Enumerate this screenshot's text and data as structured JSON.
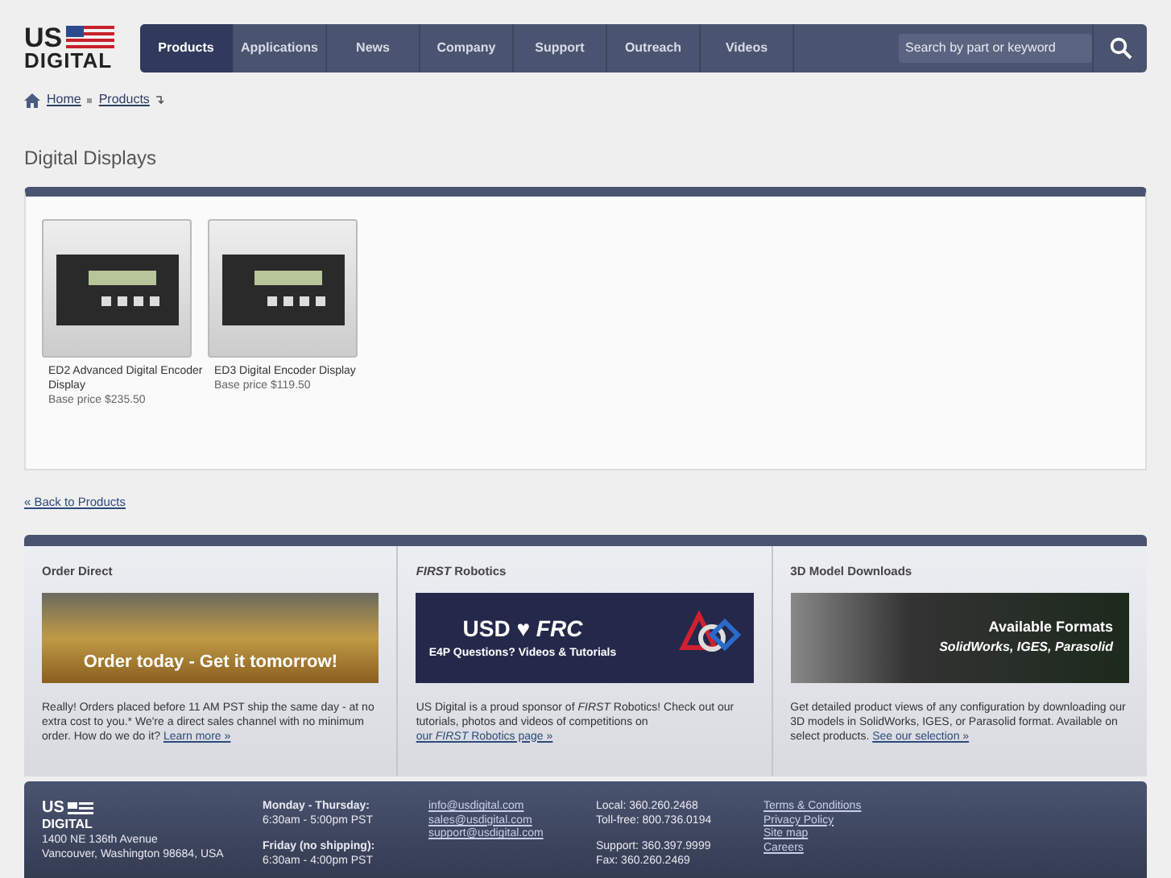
{
  "logo": {
    "line_1": "US",
    "line_2": "DIGITAL"
  },
  "nav": {
    "items": [
      {
        "label": "Products",
        "selected": true
      },
      {
        "label": "Applications",
        "selected": false
      },
      {
        "label": "News",
        "selected": false
      },
      {
        "label": "Company",
        "selected": false
      },
      {
        "label": "Support",
        "selected": false
      },
      {
        "label": "Outreach",
        "selected": false
      },
      {
        "label": "Videos",
        "selected": false
      }
    ],
    "search": {
      "placeholder": "Search by part or keyword"
    }
  },
  "breadcrumb": [
    "Home",
    "Products"
  ],
  "page_title": "Digital Displays",
  "products": [
    {
      "name": "ED2 Advanced Digital Encoder Display",
      "price": "Base price $235.50"
    },
    {
      "name": "ED3 Digital Encoder Display",
      "price": "Base price $119.50"
    }
  ],
  "back_link": "« Back to Products",
  "promos": [
    {
      "kind": "order",
      "title": "Order Direct",
      "banner": "Order today - Get it tomorrow!",
      "text": "Really! Orders placed before 11 AM PST ship the same day - at no extra cost to you.* We're a direct sales channel with no minimum order. How do we do it?",
      "link": "Learn more »"
    },
    {
      "kind": "robotics",
      "title": "*FIRST* Robotics",
      "banner": "USD ♥ *FRC*",
      "banner_sub": "E4P Questions? Videos & Tutorials",
      "text": "US Digital is a proud sponsor of *FIRST* Robotics! Check out our tutorials, photos and videos of competitions on",
      "link": "our *FIRST* Robotics page »"
    },
    {
      "kind": "model",
      "title": "3D Model Downloads",
      "banner": "Available Formats",
      "banner_sub": "SolidWorks, IGES, Parasolid",
      "text": "Get detailed product views of any configuration by downloading our 3D models in SolidWorks, IGES, or Parasolid format. Available on select products.",
      "link": "See our selection »"
    }
  ],
  "footer": {
    "logo_1": "US",
    "logo_2": "DIGITAL",
    "address": [
      "1400 NE 136th Avenue",
      "Vancouver, Washington 98684, USA"
    ],
    "hours": [
      {
        "label": "Monday - Thursday:",
        "time": "6:30am - 5:00pm PST"
      },
      {
        "label": "Friday (no shipping):",
        "time": "6:30am - 4:00pm PST"
      }
    ],
    "emails": [
      "info@usdigital.com",
      "sales@usdigital.com",
      "support@usdigital.com"
    ],
    "phones": [
      "Local: 360.260.2468",
      "Toll-free: 800.736.0194",
      "Support: 360.397.9999",
      "Fax: 360.260.2469"
    ],
    "links": [
      "Terms & Conditions",
      "Privacy Policy",
      "Site map",
      "Careers"
    ]
  }
}
